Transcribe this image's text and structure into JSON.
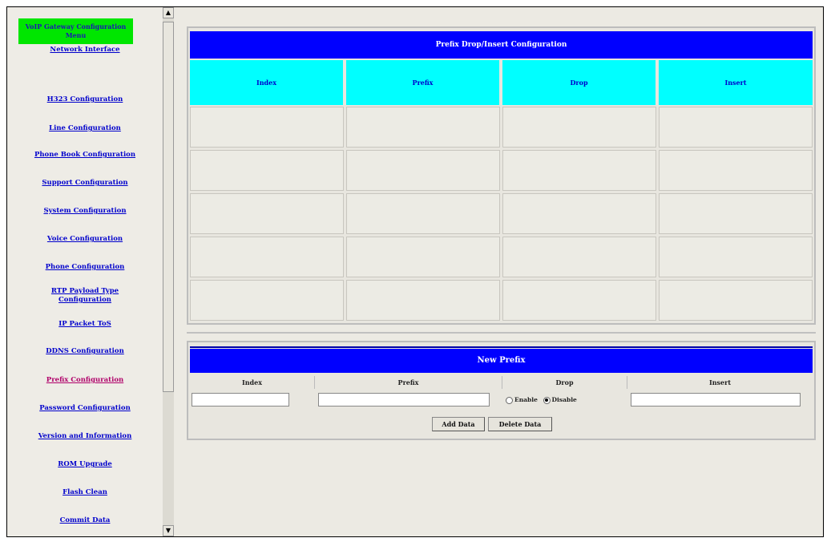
{
  "sidebar": {
    "header": "VoIP Gateway Configuration Menu",
    "items": [
      {
        "label": "Network Interface"
      },
      {
        "label": "H323 Configuration"
      },
      {
        "label": "Line Configuration"
      },
      {
        "label": "Phone Book Configuration"
      },
      {
        "label": "Support Configuration"
      },
      {
        "label": "System Configuration"
      },
      {
        "label": "Voice Configuration"
      },
      {
        "label": "Phone Configuration"
      },
      {
        "label": "RTP Payload Type Configuration"
      },
      {
        "label": "IP Packet ToS"
      },
      {
        "label": "DDNS Configuration"
      },
      {
        "label": "Prefix Configuration"
      },
      {
        "label": "Password Configuration"
      },
      {
        "label": "Version and Information"
      },
      {
        "label": "ROM Upgrade"
      },
      {
        "label": "Flash Clean"
      },
      {
        "label": "Commit Data"
      }
    ]
  },
  "scrollbar": {
    "up": "▲",
    "down": "▼"
  },
  "table": {
    "title": "Prefix Drop/Insert Configuration",
    "columns": [
      "Index",
      "Prefix",
      "Drop",
      "Insert"
    ]
  },
  "form": {
    "title": "New Prefix",
    "labels": [
      "Index",
      "Prefix",
      "Drop",
      "Insert"
    ],
    "index_value": "",
    "prefix_value": "",
    "insert_value": "",
    "enable_label": "Enable",
    "disable_label": "Disable",
    "drop_selected": "Disable",
    "add_button": "Add Data",
    "delete_button": "Delete Data"
  }
}
